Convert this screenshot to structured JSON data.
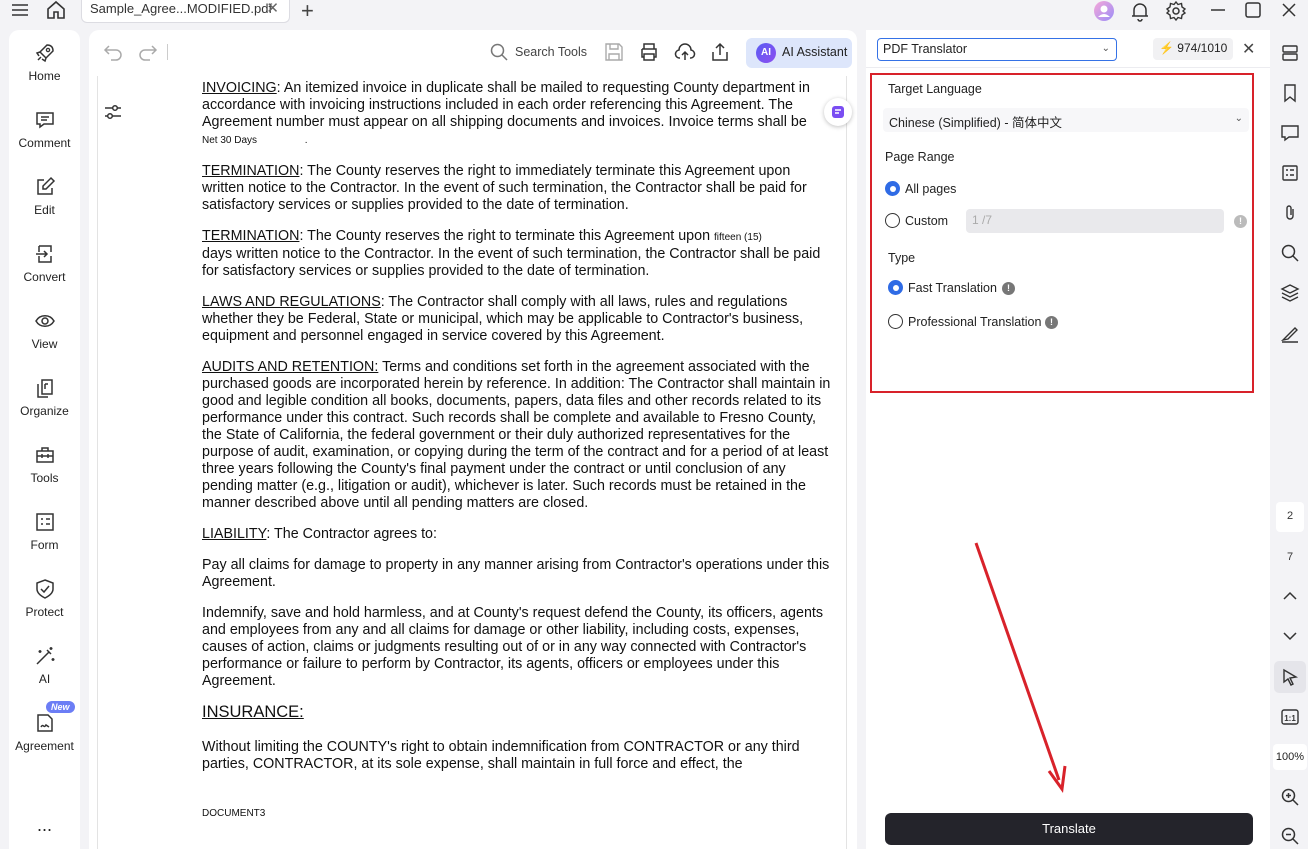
{
  "window": {
    "tab_title": "Sample_Agree...MODIFIED.pdf"
  },
  "sidebar": {
    "items": [
      {
        "label": "Home",
        "icon": "rocket-icon"
      },
      {
        "label": "Comment",
        "icon": "comment-icon"
      },
      {
        "label": "Edit",
        "icon": "edit-icon"
      },
      {
        "label": "Convert",
        "icon": "convert-icon"
      },
      {
        "label": "View",
        "icon": "eye-icon"
      },
      {
        "label": "Organize",
        "icon": "organize-icon"
      },
      {
        "label": "Tools",
        "icon": "toolbox-icon"
      },
      {
        "label": "Form",
        "icon": "form-icon"
      },
      {
        "label": "Protect",
        "icon": "shield-icon"
      },
      {
        "label": "AI",
        "icon": "magic-wand-icon"
      },
      {
        "label": "Agreement",
        "icon": "agreement-icon",
        "badge": "New"
      }
    ],
    "more": "..."
  },
  "toolbar": {
    "search_label": "Search Tools",
    "ai_label": "AI Assistant",
    "ai_logo": "AI"
  },
  "document": {
    "p1_title": "INVOICING",
    "p1_text": ": An itemized invoice in duplicate shall be mailed to requesting County department in accordance with invoicing instructions included in each order referencing this Agreement. The Agreement number must appear on all shipping documents and invoices. Invoice terms shall be",
    "p1_tail": "Net 30 Days",
    "p1_dot": ".",
    "p2_title": "TERMINATION",
    "p2_text": ": The County reserves the right to immediately terminate this Agreement upon written notice to the Contractor. In the event of such termination, the Contractor shall be paid for satisfactory services or supplies provided to the date of termination.",
    "p3_title": "TERMINATION",
    "p3_text_a": ": The County reserves the right to terminate this Agreement upon",
    "p3_small": "fifteen (15)",
    "p3_text_b": "days written notice to the Contractor. In the event of such termination, the Contractor shall be paid for satisfactory services or supplies provided to the date of termination.",
    "p4_title": "LAWS AND REGULATIONS",
    "p4_text": ": The Contractor shall comply with all laws, rules and regulations whether they be Federal, State or municipal, which may be applicable to Contractor's business, equipment and personnel engaged in service covered by this Agreement.",
    "p5_title": "AUDITS AND RETENTION:",
    "p5_text": " Terms and conditions set forth in the agreement associated with the purchased goods are incorporated herein by reference. In addition: The Contractor shall maintain in good and legible condition all books, documents, papers, data files and other records related to its performance under this contract. Such records shall be complete and available to Fresno County, the State of California, the federal government or their duly authorized representatives for the purpose of audit, examination, or copying during the term of the contract and for a period of at least three years following the County's final payment under the contract or until conclusion of any pending matter (e.g., litigation or audit), whichever is later. Such records must be retained in the manner described above until all pending matters are closed.",
    "p6_title": "LIABILITY",
    "p6_text": ":  The Contractor agrees to:",
    "p7_text": "Pay all claims for damage to property in any manner arising from Contractor's operations under this Agreement.",
    "p8_text": "Indemnify, save and hold harmless, and at County's request defend the County, its officers, agents and employees from any and all claims for damage or other liability, including costs, expenses, causes of action, claims or judgments resulting out of or in any way connected with Contractor's performance or failure to perform by Contractor, its agents, officers or employees under this Agreement.",
    "p9_title": "INSURANCE:",
    "p10_text": "Without limiting the COUNTY's right to obtain indemnification from CONTRACTOR or any third parties, CONTRACTOR, at its sole expense, shall maintain in full force and effect, the",
    "footer": "DOCUMENT3"
  },
  "translator": {
    "mode": "PDF Translator",
    "credits": "974/1010",
    "target_language_label": "Target Language",
    "target_language_value": "Chinese (Simplified) - 简体中文",
    "page_range_label": "Page Range",
    "all_pages_label": "All pages",
    "custom_label": "Custom",
    "custom_placeholder": "1 /7",
    "type_label": "Type",
    "fast_label": "Fast Translation",
    "pro_label": "Professional Translation",
    "translate_button": "Translate"
  },
  "rail": {
    "current_page": "2",
    "total_pages": "7",
    "zoom": "100%",
    "fit_label": "1:1"
  },
  "colors": {
    "accent": "#2f6be5",
    "highlight_box": "#d8222a",
    "annotation_arrow": "#d8222a",
    "button_dark": "#24242b"
  }
}
